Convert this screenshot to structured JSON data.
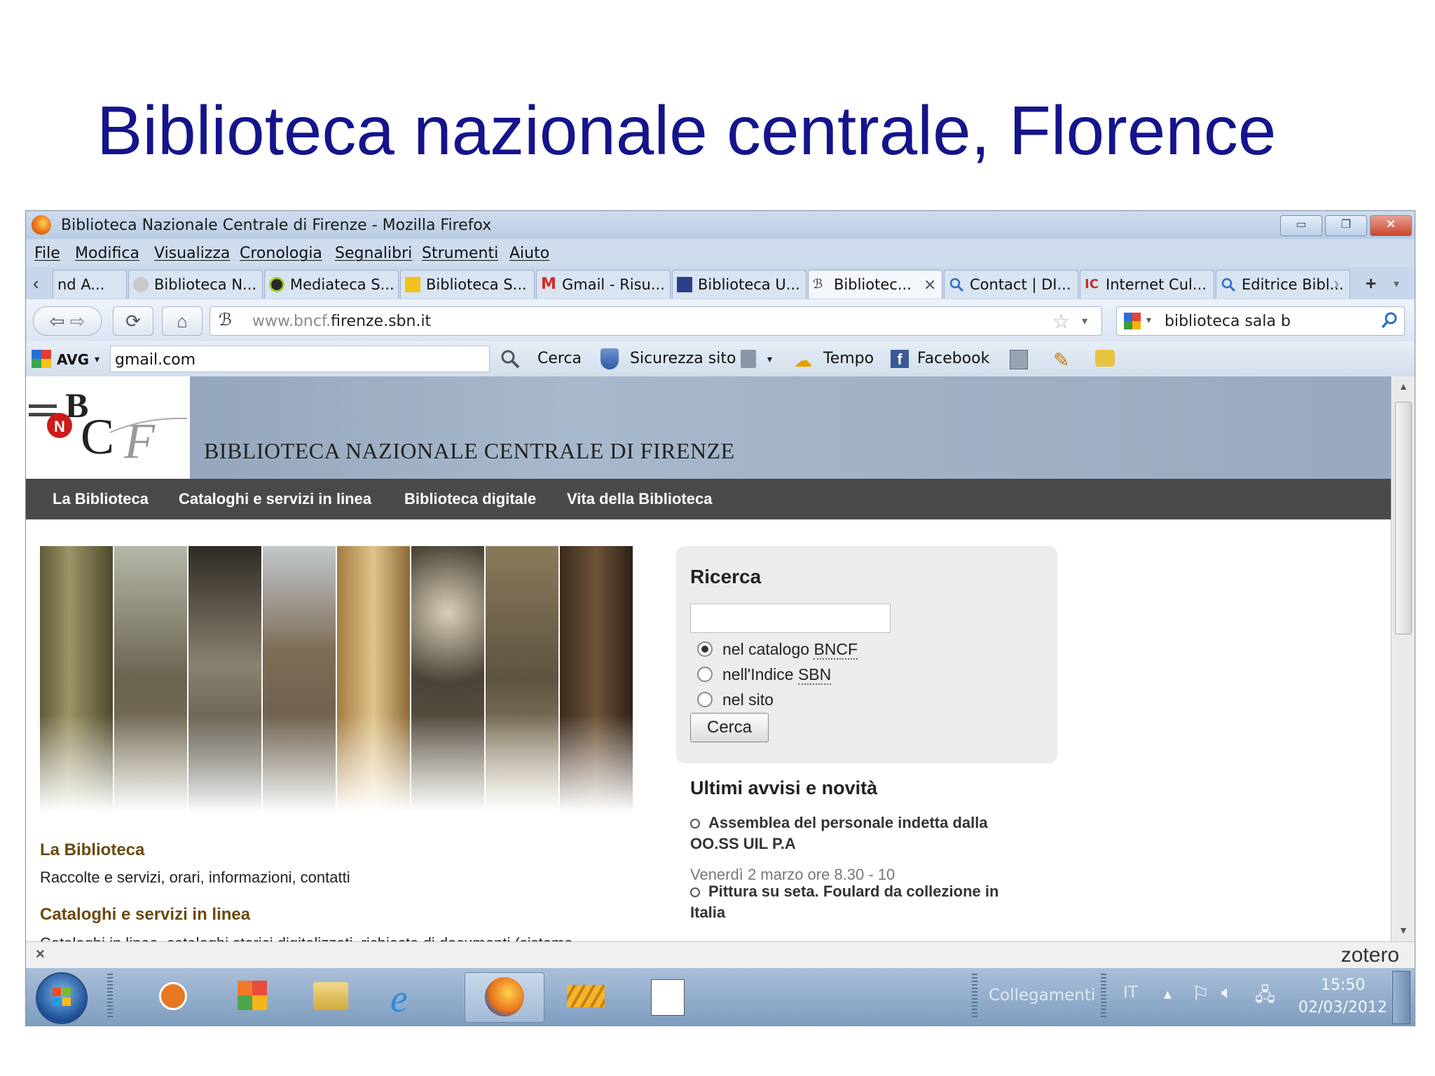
{
  "slide": {
    "title": "Biblioteca nazionale centrale, Florence"
  },
  "window": {
    "title": "Biblioteca Nazionale Centrale di Firenze - Mozilla Firefox",
    "controls": {
      "minimize": "▭",
      "restore": "❐",
      "close": "✕"
    }
  },
  "menu": [
    "File",
    "Modifica",
    "Visualizza",
    "Cronologia",
    "Segnalibri",
    "Strumenti",
    "Aiuto"
  ],
  "tabs": [
    {
      "label": "nd A...",
      "icon": "page-icon"
    },
    {
      "label": "Biblioteca N...",
      "icon": "library-icon"
    },
    {
      "label": "Mediateca S...",
      "icon": "mediateca-icon"
    },
    {
      "label": "Biblioteca S...",
      "icon": "library-icon"
    },
    {
      "label": "Gmail - Risu...",
      "icon": "gmail-icon"
    },
    {
      "label": "Biblioteca U...",
      "icon": "liuc-icon"
    },
    {
      "label": "Bibliotec...",
      "icon": "bncf-icon",
      "active": true
    },
    {
      "label": "Contact | DI...",
      "icon": "search-icon"
    },
    {
      "label": "Internet Cul...",
      "icon": "internet-culturale-icon"
    },
    {
      "label": "Editrice Bibl...",
      "icon": "search-icon"
    }
  ],
  "tab_close": "×",
  "tab_new": "+",
  "nav": {
    "url_domain_prefix": "www.bncf.",
    "url_domain_main": "firenze.sbn.it",
    "search_value": "biblioteca sala b"
  },
  "avg_toolbar": {
    "brand": "AVG",
    "search_value": "gmail.com",
    "search_button": "Cerca",
    "security": "Sicurezza sito",
    "weather": "Tempo",
    "facebook": "Facebook"
  },
  "site": {
    "header_title": "BIBLIOTECA NAZIONALE CENTRALE DI FIRENZE",
    "nav": [
      "La Biblioteca",
      "Cataloghi e servizi in linea",
      "Biblioteca digitale",
      "Vita della Biblioteca"
    ],
    "sections": [
      {
        "heading": "La Biblioteca",
        "text": "Raccolte e servizi, orari, informazioni, contatti"
      },
      {
        "heading": "Cataloghi e servizi in linea",
        "text": "Cataloghi in linea, cataloghi storici digitalizzati, richiesta di documenti (sistema"
      }
    ],
    "search": {
      "title": "Ricerca",
      "options": [
        {
          "prefix": "nel catalogo ",
          "link": "BNCF",
          "checked": true
        },
        {
          "prefix": "nell'Indice ",
          "link": "SBN",
          "checked": false
        },
        {
          "prefix": "nel sito",
          "link": "",
          "checked": false
        }
      ],
      "button": "Cerca"
    },
    "news": {
      "title": "Ultimi avvisi e novità",
      "items": [
        {
          "text": "Assemblea del personale indetta dalla OO.SS UIL P.A",
          "date": "Venerdì 2 marzo ore 8.30 - 10"
        },
        {
          "text": "Pittura su seta. Foulard da collezione in Italia",
          "date": ""
        }
      ]
    }
  },
  "zotero": "zotero",
  "taskbar": {
    "links_label": "Collegamenti",
    "lang": "IT",
    "time": "15:50",
    "date": "02/03/2012"
  }
}
